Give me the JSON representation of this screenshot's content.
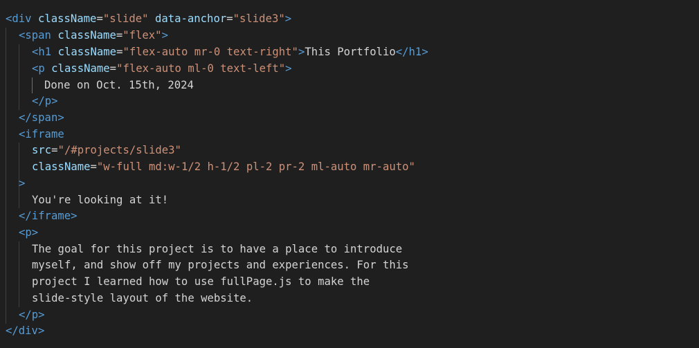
{
  "colors": {
    "background": "#1f1f1f",
    "tag": "#569cd6",
    "attribute": "#9cdcfe",
    "string": "#ce9178",
    "text": "#d4d4d4",
    "indent_guide": "#404040",
    "indent_guide_active": "#707070"
  },
  "code": {
    "l1": {
      "open": "<div",
      "a1": "className",
      "eq1": "=",
      "v1": "\"slide\"",
      "a2": "data-anchor",
      "eq2": "=",
      "v2": "\"slide3\"",
      "close": ">"
    },
    "l2": {
      "open": "<span",
      "a1": "className",
      "eq1": "=",
      "v1": "\"flex\"",
      "close": ">"
    },
    "l3": {
      "open": "<h1",
      "a1": "className",
      "eq1": "=",
      "v1": "\"flex-auto mr-0 text-right\"",
      "close": ">",
      "text": "This Portfolio",
      "end": "</h1>"
    },
    "l4": {
      "open": "<p",
      "a1": "className",
      "eq1": "=",
      "v1": "\"flex-auto ml-0 text-left\"",
      "close": ">"
    },
    "l5": {
      "text": "Done on Oct. 15th, 2024"
    },
    "l6": {
      "end": "</p>"
    },
    "l7": {
      "end": "</span>"
    },
    "l8": {
      "open": "<iframe"
    },
    "l9": {
      "a1": "src",
      "eq1": "=",
      "v1": "\"/#projects/slide3\""
    },
    "l10": {
      "a1": "className",
      "eq1": "=",
      "v1": "\"w-full md:w-1/2 h-1/2 pl-2 pr-2 ml-auto mr-auto\""
    },
    "l11": {
      "close": ">"
    },
    "l12": {
      "text": "You're looking at it!"
    },
    "l13": {
      "end": "</iframe>"
    },
    "l14": {
      "open": "<p>"
    },
    "l15": {
      "text": "The goal for this project is to have a place to introduce"
    },
    "l16": {
      "text": "myself, and show off my projects and experiences. For this"
    },
    "l17": {
      "text": "project I learned how to use fullPage.js to make the"
    },
    "l18": {
      "text": "slide-style layout of the website."
    },
    "l19": {
      "end": "</p>"
    },
    "l20": {
      "end": "</div>"
    }
  }
}
